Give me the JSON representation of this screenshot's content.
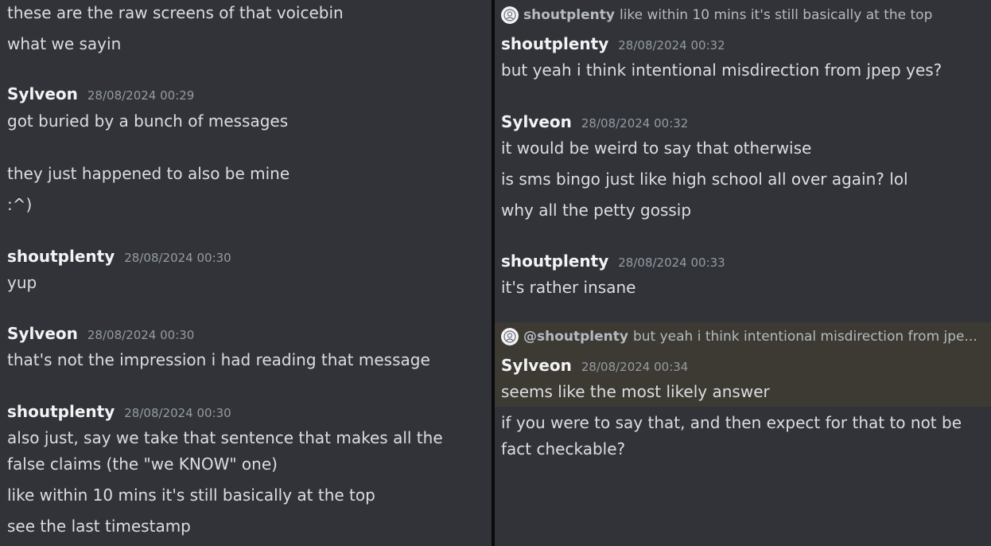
{
  "left": {
    "lines": [
      "these are the raw screens of that voicebin",
      "what we sayin"
    ],
    "messages": [
      {
        "username": "Sylveon",
        "timestamp": "28/08/2024 00:29",
        "lines": [
          "got buried by a bunch of messages",
          "they just happened to also be mine",
          ":^)"
        ]
      },
      {
        "username": "shoutplenty",
        "timestamp": "28/08/2024 00:30",
        "lines": [
          "yup"
        ]
      },
      {
        "username": "Sylveon",
        "timestamp": "28/08/2024 00:30",
        "lines": [
          "that's not the impression i had reading that message"
        ]
      },
      {
        "username": "shoutplenty",
        "timestamp": "28/08/2024 00:30",
        "lines": [
          "also just, say we take that sentence that makes all the false claims (the \"we KNOW\" one)",
          "like within 10 mins it's still basically at the top",
          "see the last timestamp"
        ]
      }
    ]
  },
  "right": {
    "reply_top": {
      "name": "shoutplenty",
      "text": "like within 10 mins it's still basically at the top"
    },
    "messages": [
      {
        "username": "shoutplenty",
        "timestamp": "28/08/2024 00:32",
        "lines": [
          "but yeah i think intentional misdirection from jpep yes?"
        ]
      },
      {
        "username": "Sylveon",
        "timestamp": "28/08/2024 00:32",
        "lines": [
          "it would be weird to say that otherwise",
          "is sms bingo just like high school all over again? lol",
          "why all the petty gossip"
        ]
      },
      {
        "username": "shoutplenty",
        "timestamp": "28/08/2024 00:33",
        "lines": [
          "it's rather insane"
        ]
      },
      {
        "username": "Sylveon",
        "timestamp": "28/08/2024 00:34",
        "lines": [
          "seems like the most likely answer",
          "if you were to say that, and then expect for that to not be fact checkable?"
        ]
      }
    ],
    "reply_mention": {
      "name": "@shoutplenty",
      "text": "but yeah i think intentional misdirection from jpe..."
    }
  }
}
